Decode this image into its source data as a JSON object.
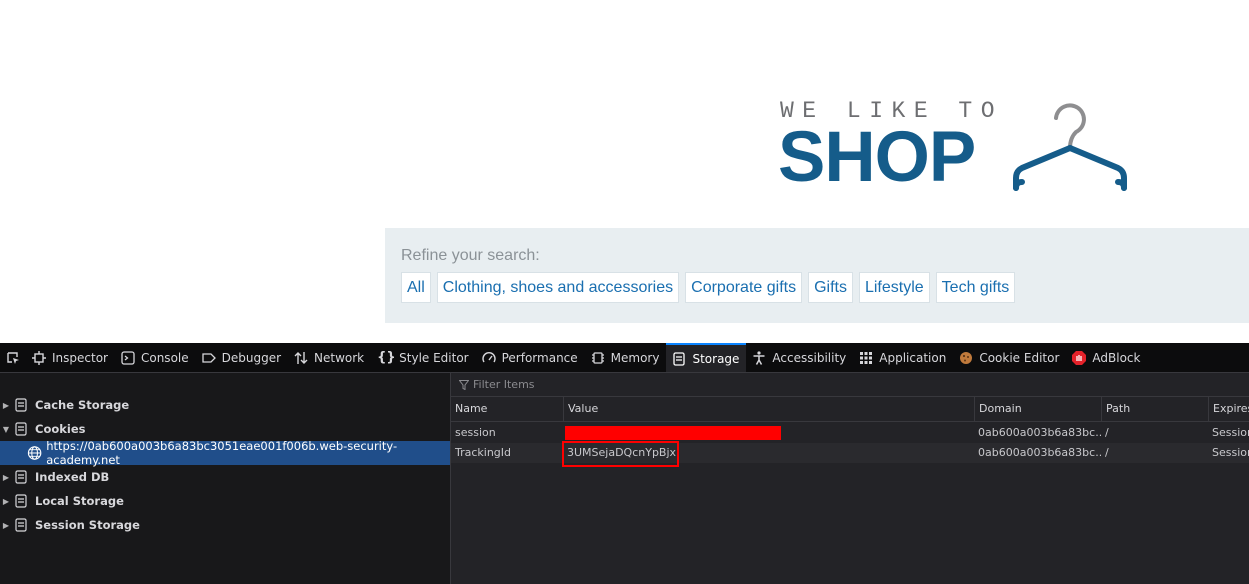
{
  "page": {
    "logo": {
      "top_text": "WE LIKE TO",
      "main_text": "SHOP"
    },
    "refine_label": "Refine your search:",
    "categories": [
      "All",
      "Clothing, shoes and accessories",
      "Corporate gifts",
      "Gifts",
      "Lifestyle",
      "Tech gifts"
    ]
  },
  "devtools": {
    "tabs": [
      "Inspector",
      "Console",
      "Debugger",
      "Network",
      "Style Editor",
      "Performance",
      "Memory",
      "Storage",
      "Accessibility",
      "Application",
      "Cookie Editor",
      "AdBlock"
    ],
    "active_tab": "Storage",
    "sidebar": {
      "cache_storage": "Cache Storage",
      "cookies": "Cookies",
      "cookie_host": "https://0ab600a003b6a83bc3051eae001f006b.web-security-academy.net",
      "indexed_db": "Indexed DB",
      "local_storage": "Local Storage",
      "session_storage": "Session Storage"
    },
    "filter_placeholder": "Filter Items",
    "columns": {
      "name": "Name",
      "value": "Value",
      "domain": "Domain",
      "path": "Path",
      "expires": "Expires"
    },
    "rows": [
      {
        "name": "session",
        "value": "",
        "domain": "0ab600a003b6a83bc...",
        "path": "/",
        "expires": "Session"
      },
      {
        "name": "TrackingId",
        "value": "3UMSejaDQcnYpBjx'",
        "domain": "0ab600a003b6a83bc...",
        "path": "/",
        "expires": "Session"
      }
    ],
    "colors": {
      "accent": "#0a84ff",
      "selected_row": "#204e8a",
      "annotation": "#ff0000"
    }
  }
}
